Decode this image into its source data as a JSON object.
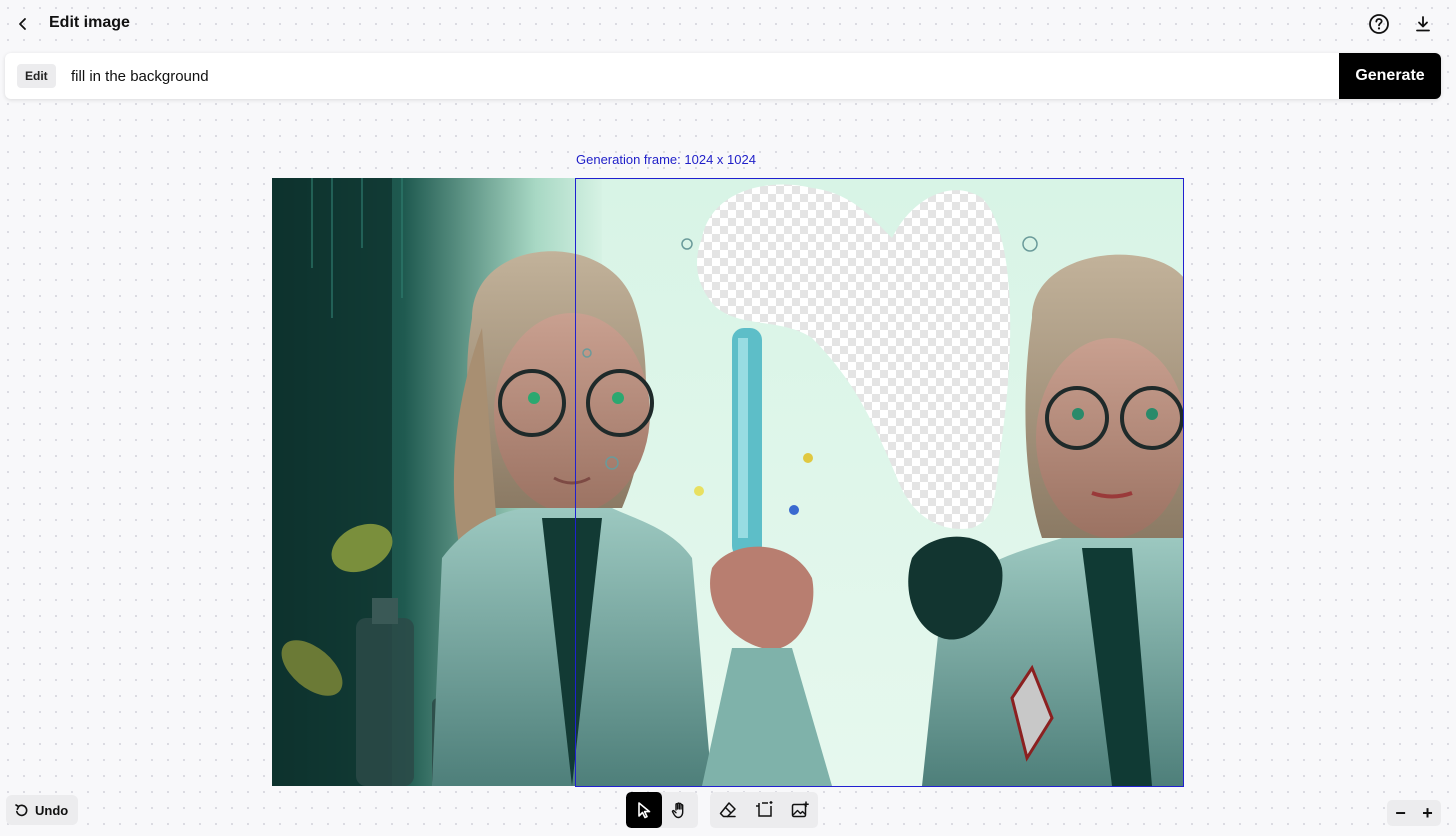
{
  "header": {
    "title": "Edit image",
    "back_icon": "chevron-left-icon",
    "help_icon": "question-circle-icon",
    "download_icon": "download-icon"
  },
  "prompt": {
    "mode_badge": "Edit",
    "value": "fill in the background",
    "generate_label": "Generate"
  },
  "canvas": {
    "frame_label": "Generation frame: 1024 x 1024",
    "frame_color": "#2020d0"
  },
  "toolbar": {
    "undo_label": "Undo",
    "tools": [
      {
        "name": "select-tool",
        "icon": "cursor-arrow-icon",
        "active": true
      },
      {
        "name": "pan-tool",
        "icon": "hand-icon",
        "active": false
      },
      {
        "name": "eraser-tool",
        "icon": "eraser-icon",
        "active": false
      },
      {
        "name": "add-frame-tool",
        "icon": "add-frame-icon",
        "active": false
      },
      {
        "name": "upload-image-tool",
        "icon": "image-plus-icon",
        "active": false
      }
    ]
  },
  "zoom": {
    "zoom_out_label": "−",
    "zoom_in_label": "+"
  },
  "colors": {
    "accent": "#000000",
    "frame": "#2020d0",
    "background": "#f8f8fa"
  }
}
